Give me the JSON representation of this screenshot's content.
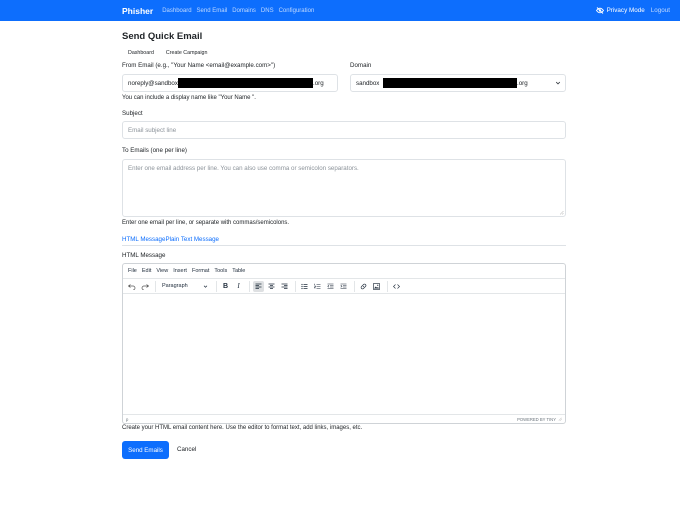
{
  "nav": {
    "brand": "Phisher",
    "links": [
      "Dashboard",
      "Send Email",
      "Domains",
      "DNS",
      "Configuration"
    ],
    "privacy_mode": "Privacy Mode",
    "logout": "Logout"
  },
  "page": {
    "title": "Send Quick Email",
    "breadcrumbs": [
      "Dashboard",
      "Create Campaign"
    ]
  },
  "form": {
    "from_label": "From Email (e.g., \"Your Name <email@example.com>\")",
    "from_value_start": "noreply@sandbox",
    "from_value_end": ".org",
    "from_help": "You can include a display name like \"Your Name \".",
    "domain_label": "Domain",
    "domain_value_start": "sandbox",
    "domain_value_end": ".org",
    "subject_label": "Subject",
    "subject_placeholder": "Email subject line",
    "to_label": "To Emails (one per line)",
    "to_placeholder": "Enter one email address per line. You can also use comma or semicolon separators.",
    "to_help": "Enter one email per line, or separate with commas/semicolons.",
    "tabs": [
      "HTML Message",
      "Plain Text Message"
    ],
    "html_label": "HTML Message",
    "editor_help": "Create your HTML email content here. Use the editor to format text, add links, images, etc.",
    "send_button": "Send Emails",
    "cancel": "Cancel"
  },
  "editor": {
    "menu": [
      "File",
      "Edit",
      "View",
      "Insert",
      "Format",
      "Tools",
      "Table"
    ],
    "block_format": "Paragraph",
    "status_path": "p",
    "powered_by": "POWERED BY TINY"
  },
  "colors": {
    "primary": "#0d6efd",
    "border": "#dee2e6",
    "text": "#212529"
  }
}
